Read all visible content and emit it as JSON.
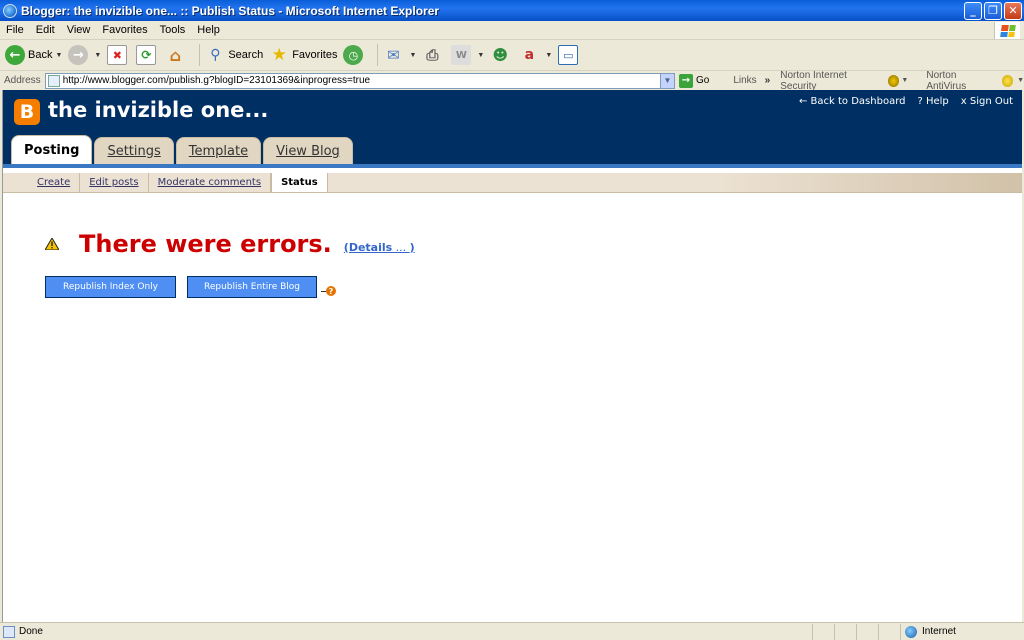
{
  "window": {
    "title": "Blogger: the invizible one... :: Publish Status - Microsoft Internet Explorer",
    "buttons": [
      "minimize",
      "maximize",
      "close"
    ]
  },
  "menubar": {
    "items": [
      "File",
      "Edit",
      "View",
      "Favorites",
      "Tools",
      "Help"
    ]
  },
  "toolbar": {
    "back_label": "Back",
    "search_label": "Search",
    "favorites_label": "Favorites"
  },
  "addressbar": {
    "label": "Address",
    "url": "http://www.blogger.com/publish.g?blogID=23101369&inprogress=true",
    "go_label": "Go",
    "links_label": "Links",
    "chevron": "»",
    "norton_security": "Norton Internet Security",
    "norton_antivirus": "Norton AntiVirus"
  },
  "blogger": {
    "logo_letter": "B",
    "blog_title": "the invizible one...",
    "top_links": {
      "dashboard": "← Back to Dashboard",
      "help": "? Help",
      "signout": "x Sign Out"
    },
    "tabs": [
      {
        "label": "Posting",
        "active": true
      },
      {
        "label": "Settings",
        "active": false
      },
      {
        "label": "Template",
        "active": false
      },
      {
        "label": "View Blog",
        "active": false
      }
    ],
    "subnav": [
      {
        "label": "Create",
        "active": false
      },
      {
        "label": "Edit posts",
        "active": false
      },
      {
        "label": "Moderate comments",
        "active": false
      },
      {
        "label": "Status",
        "active": true
      }
    ],
    "error_heading": "There were errors.",
    "details_label": "(Details",
    "details_dots": " ... ",
    "details_close": ")",
    "republish_index": "Republish Index Only",
    "republish_entire": "Republish Entire Blog",
    "help_glyph": "?"
  },
  "statusbar": {
    "status_text": "Done",
    "zone": "Internet"
  },
  "colors": {
    "header_bg": "#003063",
    "error_red": "#cc0000",
    "button_blue": "#4f8ff4",
    "logo_orange": "#f57d00"
  }
}
